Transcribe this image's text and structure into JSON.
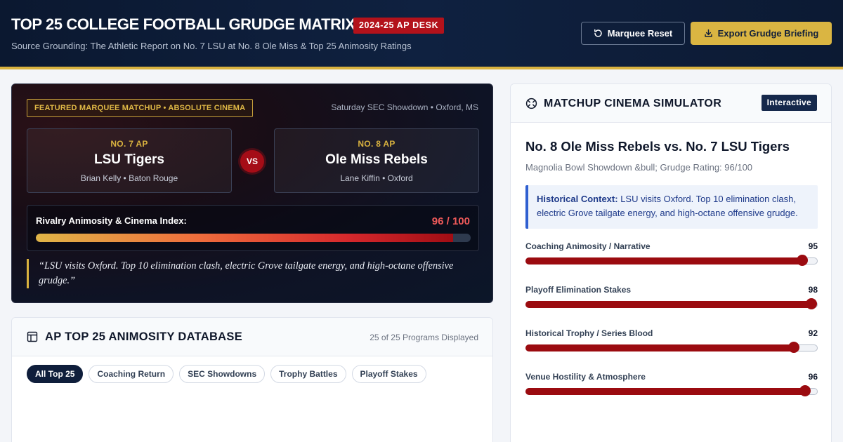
{
  "header": {
    "title": "TOP 25 COLLEGE FOOTBALL GRUDGE MATRIX",
    "badge": "2024-25 AP DESK",
    "subtitle": "Source Grounding: The Athletic Report on No. 7 LSU at No. 8 Ole Miss & Top 25 Animosity Ratings",
    "reset_label": "Marquee Reset",
    "export_label": "Export Grudge Briefing"
  },
  "featured": {
    "tag": "FEATURED MARQUEE MATCHUP • ABSOLUTE CINEMA",
    "venue": "Saturday SEC Showdown • Oxford, MS",
    "teams": [
      {
        "rank": "NO. 7 AP",
        "name": "LSU Tigers",
        "meta": "Brian Kelly • Baton Rouge"
      },
      {
        "rank": "NO. 8 AP",
        "name": "Ole Miss Rebels",
        "meta": "Lane Kiffin • Oxford"
      }
    ],
    "vs_label": "VS",
    "index_label": "Rivalry Animosity & Cinema Index:",
    "index_score": "96 / 100",
    "index_value": 96,
    "index_max": 100,
    "quote": "“LSU visits Oxford. Top 10 elimination clash, electric Grove tailgate energy, and high-octane offensive grudge.”"
  },
  "database": {
    "title": "AP TOP 25 ANIMOSITY DATABASE",
    "count": "25 of 25 Programs Displayed",
    "filters": [
      "All Top 25",
      "Coaching Return",
      "SEC Showdowns",
      "Trophy Battles",
      "Playoff Stakes"
    ],
    "active_filter": "All Top 25"
  },
  "simulator": {
    "title": "MATCHUP CINEMA SIMULATOR",
    "badge": "Interactive",
    "matchup": "No. 8 Ole Miss Rebels vs. No. 7 LSU Tigers",
    "subtitle": "Magnolia Bowl Showdown &bull; Grudge Rating: 96/100",
    "context_label": "Historical Context:",
    "context_text": "LSU visits Oxford. Top 10 elimination clash, electric Grove tailgate energy, and high-octane offensive grudge.",
    "sliders": [
      {
        "label": "Coaching Animosity / Narrative",
        "value": 95
      },
      {
        "label": "Playoff Elimination Stakes",
        "value": 98
      },
      {
        "label": "Historical Trophy / Series Blood",
        "value": 92
      },
      {
        "label": "Venue Hostility & Atmosphere",
        "value": 96
      }
    ]
  },
  "colors": {
    "navy": "#0b1830",
    "gold": "#d9b23f",
    "crimson": "#9b0b10",
    "badge_red": "#b3121b",
    "context_blue": "#2f5fd0"
  }
}
